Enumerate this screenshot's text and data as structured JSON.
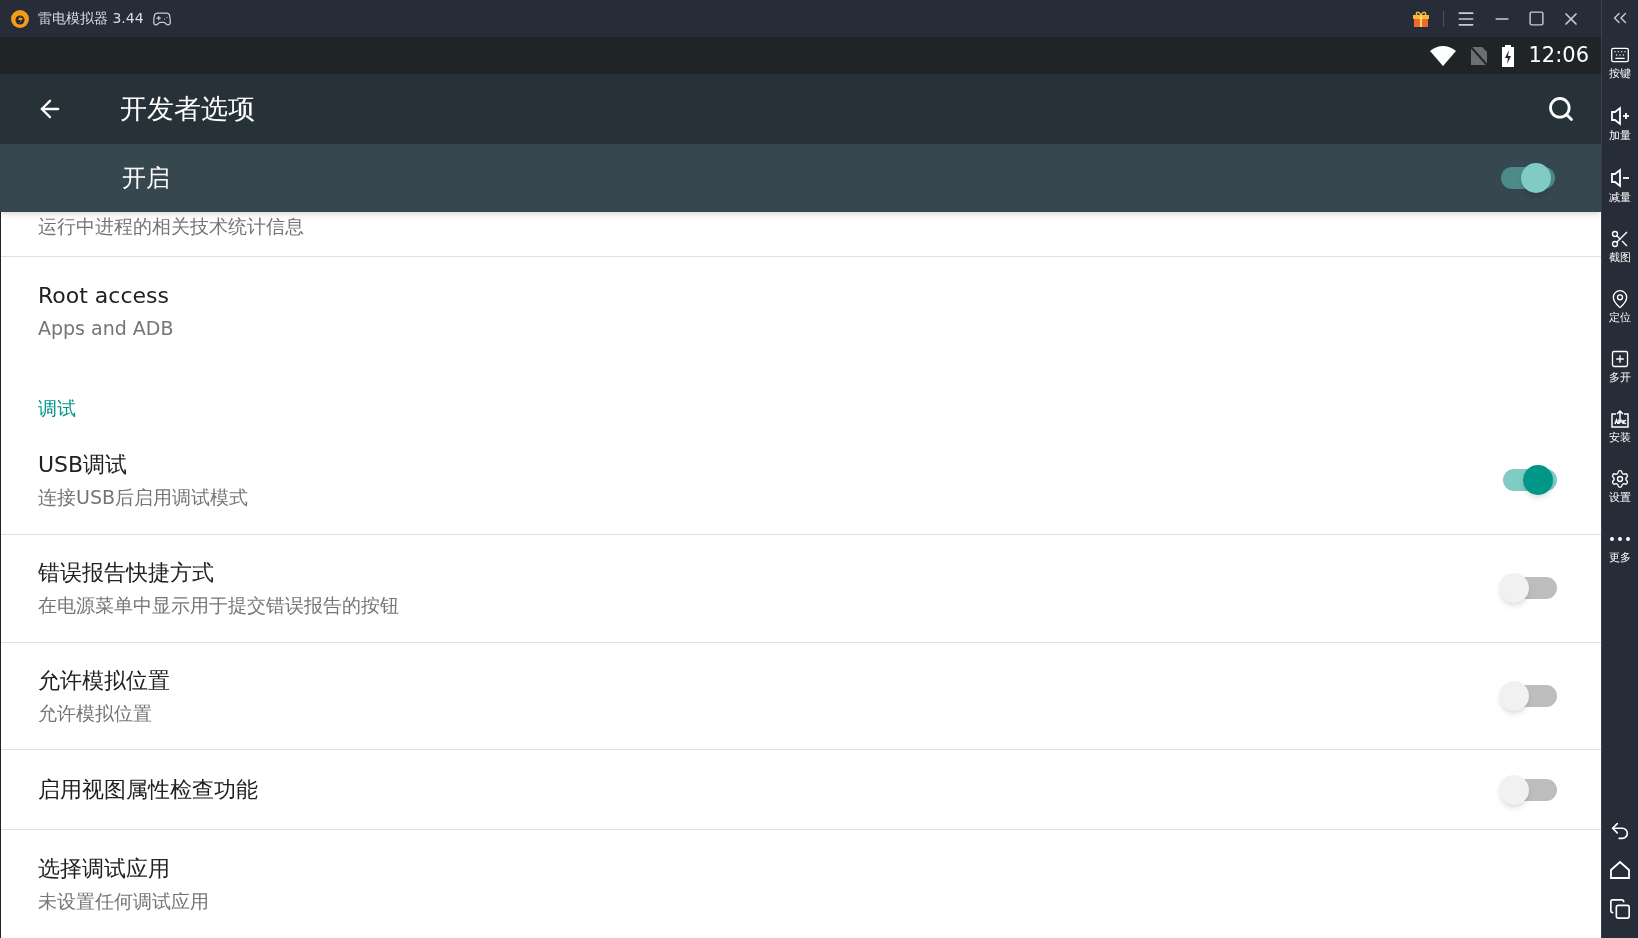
{
  "app": {
    "title": "雷电模拟器 3.44"
  },
  "status_bar": {
    "time": "12:06"
  },
  "toolbar": {
    "title": "开发者选项"
  },
  "master_switch": {
    "label": "开启",
    "on": true
  },
  "settings": [
    {
      "kind": "partial",
      "summary": "运行中进程的相关技术统计信息"
    },
    {
      "kind": "item",
      "title": "Root access",
      "summary": "Apps and ADB"
    },
    {
      "kind": "header",
      "title": "调试"
    },
    {
      "kind": "switch",
      "title": "USB调试",
      "summary": "连接USB后启用调试模式",
      "on": true
    },
    {
      "kind": "switch",
      "title": "错误报告快捷方式",
      "summary": "在电源菜单中显示用于提交错误报告的按钮",
      "on": false
    },
    {
      "kind": "switch",
      "title": "允许模拟位置",
      "summary": "允许模拟位置",
      "on": false
    },
    {
      "kind": "switch",
      "title": "启用视图属性检查功能",
      "on": false
    },
    {
      "kind": "item",
      "title": "选择调试应用",
      "summary": "未设置任何调试应用"
    }
  ],
  "sidebar": {
    "tools": [
      {
        "kind": "keyboard",
        "label": "按键"
      },
      {
        "kind": "volume-up",
        "label": "加量"
      },
      {
        "kind": "volume-down",
        "label": "减量"
      },
      {
        "kind": "scissors",
        "label": "截图"
      },
      {
        "kind": "location",
        "label": "定位"
      },
      {
        "kind": "multi",
        "label": "多开"
      },
      {
        "kind": "apk",
        "label": "安装"
      },
      {
        "kind": "settings",
        "label": "设置"
      },
      {
        "kind": "more",
        "label": "更多"
      }
    ],
    "nav": [
      {
        "kind": "back"
      },
      {
        "kind": "home"
      },
      {
        "kind": "recents"
      }
    ]
  }
}
